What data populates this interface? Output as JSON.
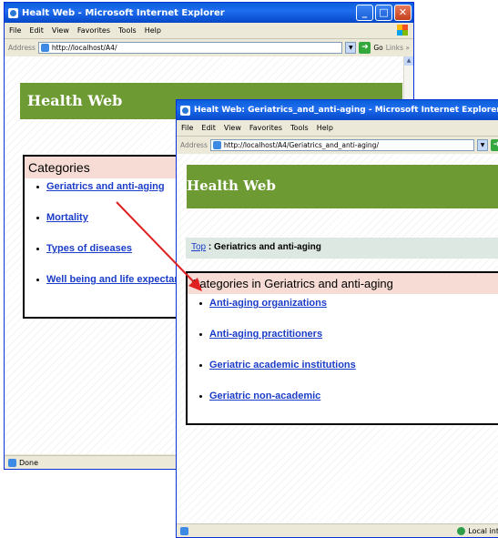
{
  "back_window": {
    "title": "Healt Web - Microsoft Internet Explorer",
    "menu": [
      "File",
      "Edit",
      "View",
      "Favorites",
      "Tools",
      "Help"
    ],
    "address_label": "Address",
    "address_url": "http://localhost/A4/",
    "go_label": "Go",
    "links_label": "Links »",
    "site_title": "Health Web",
    "categories_heading": "Categories",
    "categories": [
      "Geriatrics and anti-aging",
      "Mortality",
      "Types of diseases",
      "Well being and life expectan"
    ],
    "status": "Done"
  },
  "front_window": {
    "title": "Healt Web: Geriatrics_and_anti-aging - Microsoft Internet Explorer",
    "menu": [
      "File",
      "Edit",
      "View",
      "Favorites",
      "Tools",
      "Help"
    ],
    "address_label": "Address",
    "address_url": "http://localhost/A4/Geriatrics_and_anti-aging/",
    "site_title": "Health Web",
    "breadcrumb_link": "Top",
    "breadcrumb_rest": " : Geriatrics and anti-aging",
    "categories_heading": "Categories in Geriatrics and anti-aging",
    "categories": [
      "Anti-aging organizations",
      "Anti-aging practitioners",
      "Geriatric academic institutions",
      "Geriatric non-academic"
    ],
    "status_zone": "Local int"
  },
  "colors": {
    "title_bar": "#0a5fd8",
    "banner": "#6e9a33",
    "category_header": "#f7dcd5",
    "breadcrumb_bg": "#dde8e3",
    "link": "#1a3cc8",
    "arrow": "#e02020"
  },
  "icons": [
    "ie-logo-icon",
    "minimize-icon",
    "maximize-icon",
    "close-icon",
    "windows-flag-icon",
    "page-icon",
    "go-arrow-icon",
    "globe-icon"
  ]
}
